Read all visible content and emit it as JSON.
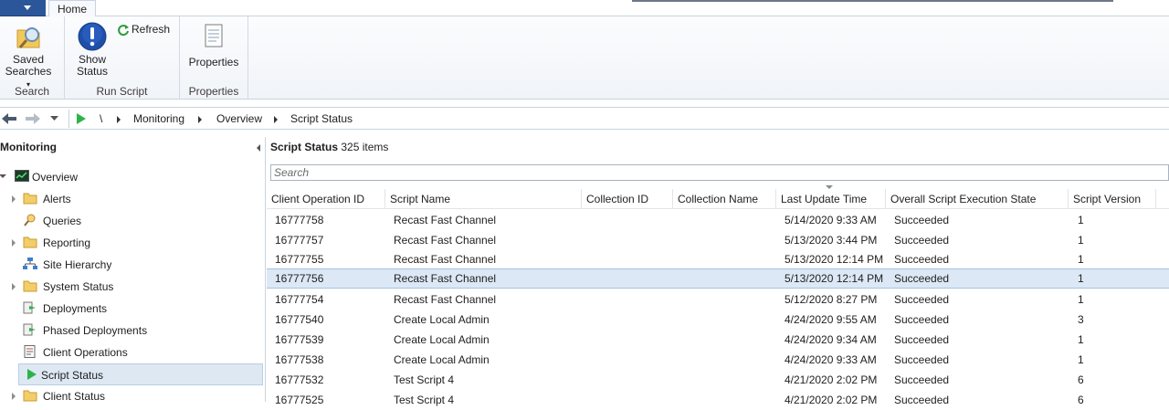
{
  "tabs": {
    "home": "Home"
  },
  "ribbon": {
    "saved_searches": "Saved\nSearches",
    "saved_searches_line1": "Saved",
    "saved_searches_line2": "Searches",
    "show_status_line1": "Show",
    "show_status_line2": "Status",
    "refresh": "Refresh",
    "properties": "Properties",
    "group_search": "Search",
    "group_run_script": "Run Script",
    "group_properties": "Properties"
  },
  "address": {
    "root": "\\",
    "crumbs": [
      "Monitoring",
      "Overview",
      "Script Status"
    ]
  },
  "nav": {
    "title": "Monitoring",
    "items": [
      {
        "label": "Overview",
        "icon": "overview-icon"
      },
      {
        "label": "Alerts",
        "icon": "folder-icon"
      },
      {
        "label": "Queries",
        "icon": "query-icon"
      },
      {
        "label": "Reporting",
        "icon": "folder-icon"
      },
      {
        "label": "Site Hierarchy",
        "icon": "hierarchy-icon"
      },
      {
        "label": "System Status",
        "icon": "folder-icon"
      },
      {
        "label": "Deployments",
        "icon": "deployment-icon"
      },
      {
        "label": "Phased Deployments",
        "icon": "phased-deployment-icon"
      },
      {
        "label": "Client Operations",
        "icon": "client-operations-icon"
      },
      {
        "label": "Script Status",
        "icon": "script-status-icon"
      },
      {
        "label": "Client Status",
        "icon": "folder-icon"
      }
    ]
  },
  "list": {
    "title": "Script Status",
    "count": "325 items",
    "search_placeholder": "Search",
    "columns": [
      "Client Operation ID",
      "Script Name",
      "Collection ID",
      "Collection Name",
      "Last Update Time",
      "Overall Script Execution State",
      "Script Version"
    ],
    "rows": [
      [
        "16777758",
        "Recast Fast Channel",
        "",
        "",
        "5/14/2020 9:33 AM",
        "Succeeded",
        "1"
      ],
      [
        "16777757",
        "Recast Fast Channel",
        "",
        "",
        "5/13/2020 3:44 PM",
        "Succeeded",
        "1"
      ],
      [
        "16777755",
        "Recast Fast Channel",
        "",
        "",
        "5/13/2020 12:14 PM",
        "Succeeded",
        "1"
      ],
      [
        "16777756",
        "Recast Fast Channel",
        "",
        "",
        "5/13/2020 12:14 PM",
        "Succeeded",
        "1"
      ],
      [
        "16777754",
        "Recast Fast Channel",
        "",
        "",
        "5/12/2020 8:27 PM",
        "Succeeded",
        "1"
      ],
      [
        "16777540",
        "Create Local Admin",
        "",
        "",
        "4/24/2020 9:55 AM",
        "Succeeded",
        "3"
      ],
      [
        "16777539",
        "Create Local Admin",
        "",
        "",
        "4/24/2020 9:34 AM",
        "Succeeded",
        "1"
      ],
      [
        "16777538",
        "Create Local Admin",
        "",
        "",
        "4/24/2020 9:33 AM",
        "Succeeded",
        "1"
      ],
      [
        "16777532",
        "Test Script 4",
        "",
        "",
        "4/21/2020 2:02 PM",
        "Succeeded",
        "6"
      ],
      [
        "16777525",
        "Test Script 4",
        "",
        "",
        "4/21/2020 2:02 PM",
        "Succeeded",
        "6"
      ]
    ],
    "selected_row": 3
  },
  "colors": {
    "accent": "#2b579a",
    "selection": "#dce8f5"
  }
}
